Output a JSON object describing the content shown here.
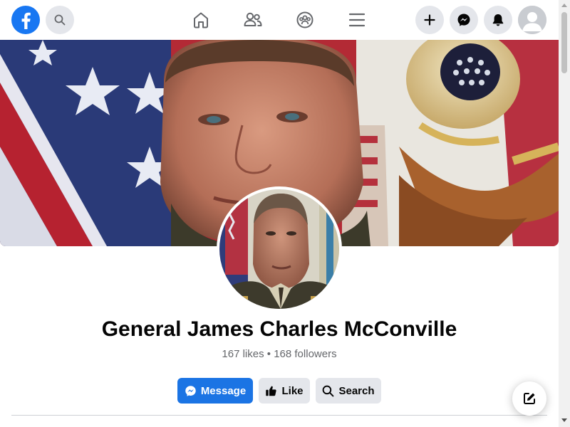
{
  "header": {
    "logo_icon": "facebook-logo-icon",
    "search_icon": "search-icon",
    "nav": [
      {
        "icon": "home-icon"
      },
      {
        "icon": "friends-icon"
      },
      {
        "icon": "groups-icon"
      },
      {
        "icon": "menu-icon"
      }
    ],
    "actions": [
      {
        "icon": "plus-icon"
      },
      {
        "icon": "messenger-icon"
      },
      {
        "icon": "bell-icon"
      },
      {
        "icon": "account-avatar-icon"
      }
    ],
    "brand_color": "#1877f2"
  },
  "profile": {
    "name": "General James Charles McConville",
    "stats": "167 likes • 168 followers"
  },
  "buttons": {
    "message": "Message",
    "like": "Like",
    "search": "Search"
  },
  "floating": {
    "compose_icon": "compose-icon"
  }
}
